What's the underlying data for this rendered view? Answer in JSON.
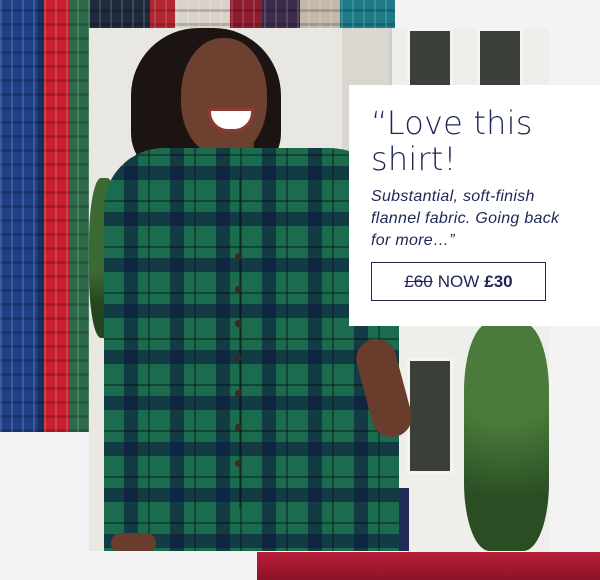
{
  "quote": {
    "headline_line1": "“Love this",
    "headline_line2": "shirt!",
    "body": "Substantial, soft-finish flannel fabric. Going back for more…”"
  },
  "price": {
    "old": "£60",
    "now_label": "NOW",
    "new": "£30"
  },
  "colors": {
    "text_navy": "#1e2656",
    "shirt_green": "#1b6b4e",
    "accent_red": "#b81e3a"
  }
}
